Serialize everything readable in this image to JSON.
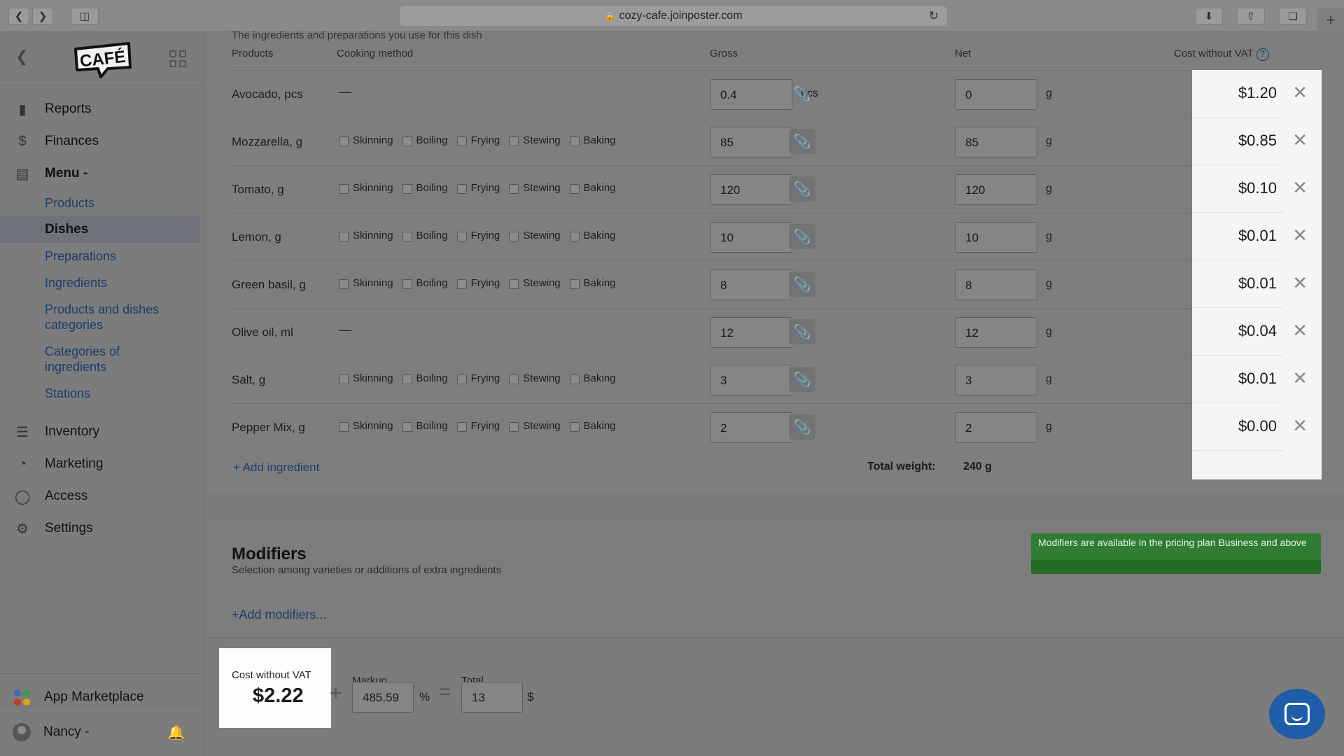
{
  "browser": {
    "url": "cozy-cafe.joinposter.com"
  },
  "sidebar": {
    "nav": {
      "reports": "Reports",
      "finances": "Finances",
      "menu": "Menu -",
      "inventory": "Inventory",
      "marketing": "Marketing",
      "access": "Access",
      "settings": "Settings"
    },
    "menu_sub": [
      "Products",
      "Dishes",
      "Preparations",
      "Ingredients",
      "Products and dishes categories",
      "Categories of ingredients",
      "Stations"
    ],
    "app_marketplace": "App Marketplace",
    "user": "Nancy -",
    "icons": [
      "chart-icon",
      "dollar-icon",
      "document-icon",
      "layers-icon",
      "marketing-icon",
      "lock-icon",
      "gear-icon",
      "apps-icon",
      "avatar-icon",
      "bell-icon"
    ]
  },
  "ingredients": {
    "subtitle": "The ingredients and preparations you use for this dish",
    "headers": {
      "products": "Products",
      "cooking": "Cooking method",
      "gross": "Gross",
      "net": "Net",
      "cost": "Cost without VAT",
      "help": "?"
    },
    "methods": [
      "Skinning",
      "Boiling",
      "Frying",
      "Stewing",
      "Baking"
    ],
    "rows": [
      {
        "name": "Avocado, pcs",
        "cooking": "—",
        "gross": "0.4",
        "gross_unit": "pcs",
        "net": "0",
        "net_unit": "g",
        "cost": "$1.20"
      },
      {
        "name": "Mozzarella, g",
        "cooking": "",
        "gross": "85",
        "gross_unit": "g",
        "net": "85",
        "net_unit": "g",
        "cost": "$0.85"
      },
      {
        "name": "Tomato, g",
        "cooking": "",
        "gross": "120",
        "gross_unit": "g",
        "net": "120",
        "net_unit": "g",
        "cost": "$0.10"
      },
      {
        "name": "Lemon, g",
        "cooking": "",
        "gross": "10",
        "gross_unit": "g",
        "net": "10",
        "net_unit": "g",
        "cost": "$0.01"
      },
      {
        "name": "Green basil, g",
        "cooking": "",
        "gross": "8",
        "gross_unit": "g",
        "net": "8",
        "net_unit": "g",
        "cost": "$0.01"
      },
      {
        "name": "Olive oil, ml",
        "cooking": "—",
        "gross": "12",
        "gross_unit": "ml",
        "net": "12",
        "net_unit": "g",
        "cost": "$0.04"
      },
      {
        "name": "Salt, g",
        "cooking": "",
        "gross": "3",
        "gross_unit": "g",
        "net": "3",
        "net_unit": "g",
        "cost": "$0.01"
      },
      {
        "name": "Pepper Mix, g",
        "cooking": "",
        "gross": "2",
        "gross_unit": "g",
        "net": "2",
        "net_unit": "g",
        "cost": "$0.00"
      }
    ],
    "add_ingredient": "+ Add ingredient",
    "total_weight_label": "Total weight:",
    "total_weight": "240 g"
  },
  "modifiers": {
    "title": "Modifiers",
    "subtitle": "Selection among varieties or additions of extra ingredients",
    "add": "+Add modifiers...",
    "plan_notice": "Modifiers are available in the pricing plan Business and above"
  },
  "pricing": {
    "cost_label": "Cost without VAT",
    "cost_value": "$2.22",
    "markup_label": "Markup",
    "markup_value": "485.59",
    "markup_unit": "%",
    "total_label": "Total",
    "total_value": "13",
    "currency": "$"
  }
}
